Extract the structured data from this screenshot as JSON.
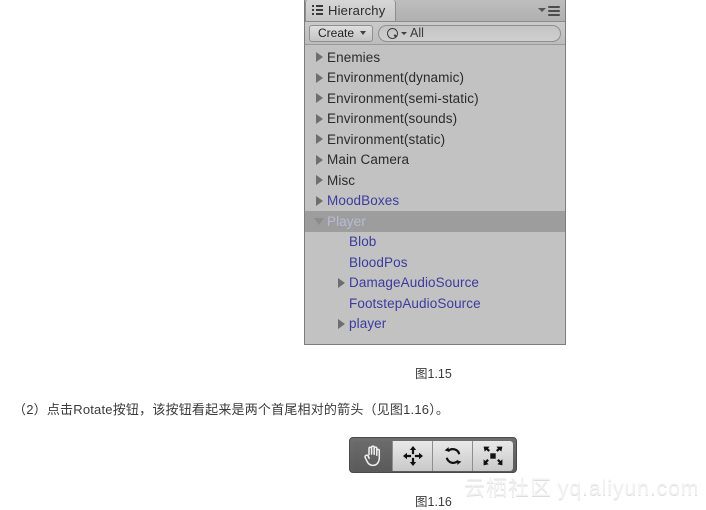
{
  "hierarchy_panel": {
    "tab": {
      "label": "Hierarchy",
      "icon": "hierarchy-list-icon"
    },
    "options_menu": {
      "icon": "panel-options-menu-icon"
    },
    "toolbar": {
      "create_label": "Create",
      "create_caret_icon": "chevron-down-icon",
      "search": {
        "value": "All",
        "placeholder": "All",
        "icon": "search-icon",
        "dropdown_icon": "chevron-down-icon"
      }
    },
    "tree": [
      {
        "label": "Enemies",
        "arrow": "right",
        "prefab": false,
        "selected": false,
        "indent": 0
      },
      {
        "label": "Environment(dynamic)",
        "arrow": "right",
        "prefab": false,
        "selected": false,
        "indent": 0
      },
      {
        "label": "Environment(semi-static)",
        "arrow": "right",
        "prefab": false,
        "selected": false,
        "indent": 0
      },
      {
        "label": "Environment(sounds)",
        "arrow": "right",
        "prefab": false,
        "selected": false,
        "indent": 0
      },
      {
        "label": "Environment(static)",
        "arrow": "right",
        "prefab": false,
        "selected": false,
        "indent": 0
      },
      {
        "label": "Main Camera",
        "arrow": "right",
        "prefab": false,
        "selected": false,
        "indent": 0
      },
      {
        "label": "Misc",
        "arrow": "right",
        "prefab": false,
        "selected": false,
        "indent": 0
      },
      {
        "label": "MoodBoxes",
        "arrow": "right",
        "prefab": true,
        "selected": false,
        "indent": 0
      },
      {
        "label": "Player",
        "arrow": "down",
        "prefab": true,
        "selected": true,
        "indent": 0
      },
      {
        "label": "Blob",
        "arrow": "none",
        "prefab": true,
        "selected": false,
        "indent": 1
      },
      {
        "label": "BloodPos",
        "arrow": "none",
        "prefab": true,
        "selected": false,
        "indent": 1
      },
      {
        "label": "DamageAudioSource",
        "arrow": "right",
        "prefab": true,
        "selected": false,
        "indent": 1
      },
      {
        "label": "FootstepAudioSource",
        "arrow": "none",
        "prefab": true,
        "selected": false,
        "indent": 1
      },
      {
        "label": "player",
        "arrow": "right",
        "prefab": true,
        "selected": false,
        "indent": 1
      }
    ],
    "colors": {
      "panel_background": "#c2c2c2",
      "selection": "#9d9d9d",
      "prefab_text": "#3b3b9e",
      "normal_text": "#2b2b2b"
    }
  },
  "figure_captions": {
    "fig_115": "图1.15",
    "fig_116": "图1.16"
  },
  "body": {
    "paragraph": "（2）点击Rotate按钮，该按钮看起来是两个首尾相对的箭头（见图1.16）。"
  },
  "tool_toolbar": {
    "buttons": [
      {
        "name": "hand-tool",
        "icon": "hand-icon",
        "active": true
      },
      {
        "name": "move-tool",
        "icon": "four-arrows-icon",
        "active": false
      },
      {
        "name": "rotate-tool",
        "icon": "rotate-arrows-icon",
        "active": false
      },
      {
        "name": "scale-tool",
        "icon": "scale-corners-icon",
        "active": false
      }
    ]
  },
  "watermark": {
    "cn": "云栖社区",
    "url": "yq.aliyun.com"
  }
}
